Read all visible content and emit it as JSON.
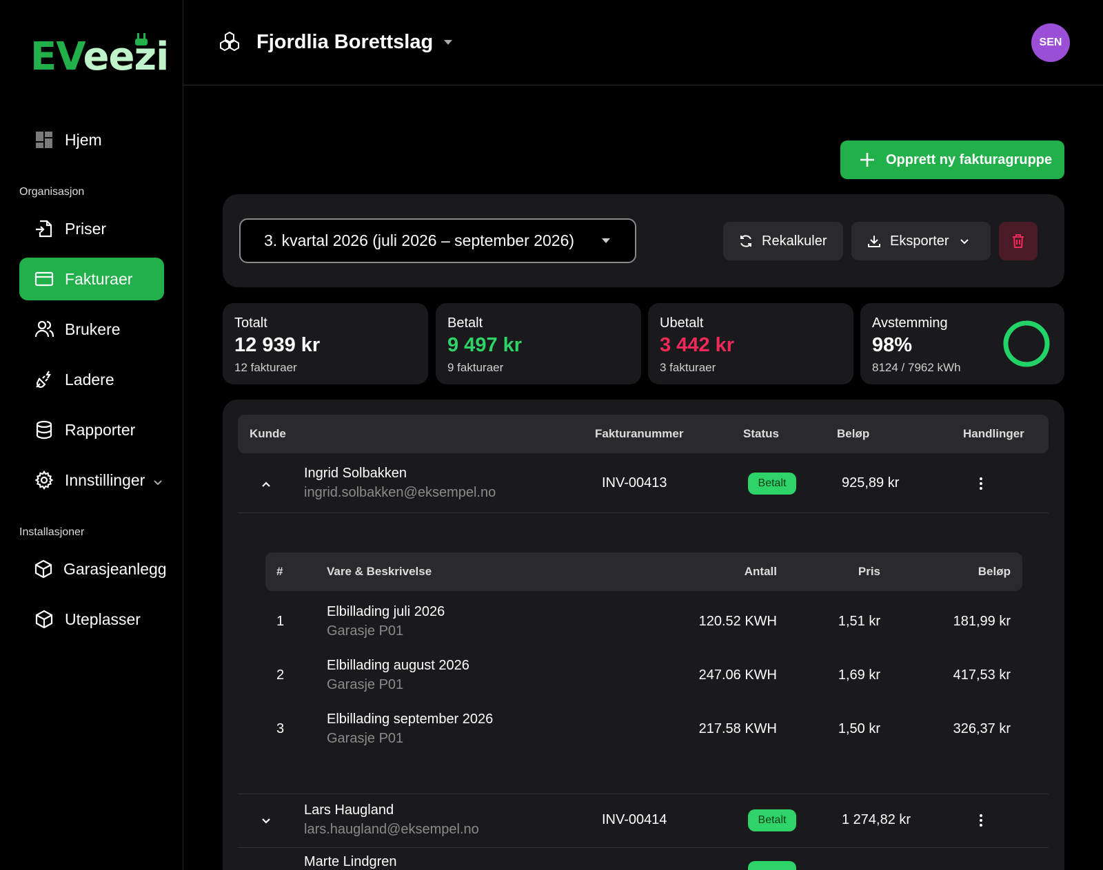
{
  "brand": {
    "logo_ev": "EV",
    "logo_eezi": "eezi",
    "accent": "#22b04b"
  },
  "sidebar": {
    "home": "Hjem",
    "section_org": "Organisasjon",
    "items": [
      {
        "label": "Priser",
        "icon": "price-import-icon"
      },
      {
        "label": "Fakturaer",
        "icon": "invoice-card-icon",
        "active": true
      },
      {
        "label": "Brukere",
        "icon": "users-icon"
      },
      {
        "label": "Ladere",
        "icon": "charger-plug-icon"
      },
      {
        "label": "Rapporter",
        "icon": "database-icon"
      },
      {
        "label": "Innstillinger",
        "icon": "gear-icon"
      }
    ],
    "section_install": "Installasjoner",
    "installs": [
      {
        "label": "Garasjeanlegg",
        "icon": "box-icon"
      },
      {
        "label": "Uteplasser",
        "icon": "box-icon"
      }
    ]
  },
  "topbar": {
    "org_name": "Fjordlia Borettslag",
    "avatar": "SEN"
  },
  "actions": {
    "create_group": "Opprett ny fakturagruppe",
    "period": "3. kvartal 2026 (juli 2026 – september 2026)",
    "recalc": "Rekalkuler",
    "export": "Eksporter"
  },
  "stats": {
    "total": {
      "label": "Totalt",
      "value": "12 939 kr",
      "sub": "12 fakturaer"
    },
    "paid": {
      "label": "Betalt",
      "value": "9 497 kr",
      "sub": "9 fakturaer",
      "color": "#2ed468"
    },
    "unpaid": {
      "label": "Ubetalt",
      "value": "3 442 kr",
      "sub": "3 fakturaer",
      "color": "#f0295a"
    },
    "reconcile": {
      "label": "Avstemming",
      "value": "98%",
      "sub": "8124 / 7962 kWh",
      "progress": 0.98
    }
  },
  "table": {
    "headers": {
      "customer": "Kunde",
      "invoice_no": "Fakturanummer",
      "status": "Status",
      "amount": "Beløp",
      "actions": "Handlinger"
    },
    "rows": [
      {
        "name": "Ingrid Solbakken",
        "email": "ingrid.solbakken@eksempel.no",
        "invoice": "INV-00413",
        "status": "Betalt",
        "amount": "925,89 kr",
        "expanded": true
      },
      {
        "name": "Lars Haugland",
        "email": "lars.haugland@eksempel.no",
        "invoice": "INV-00414",
        "status": "Betalt",
        "amount": "1 274,82 kr",
        "expanded": false
      },
      {
        "name": "Marte Lindgren"
      }
    ]
  },
  "lines": {
    "headers": {
      "num": "#",
      "item": "Vare & Beskrivelse",
      "qty": "Antall",
      "price": "Pris",
      "amount": "Beløp"
    },
    "rows": [
      {
        "num": "1",
        "desc": "Elbillading juli 2026",
        "loc": "Garasje P01",
        "qty": "120.52 KWH",
        "price": "1,51 kr",
        "amount": "181,99 kr"
      },
      {
        "num": "2",
        "desc": "Elbillading august 2026",
        "loc": "Garasje P01",
        "qty": "247.06 KWH",
        "price": "1,69 kr",
        "amount": "417,53 kr"
      },
      {
        "num": "3",
        "desc": "Elbillading september 2026",
        "loc": "Garasje P01",
        "qty": "217.58 KWH",
        "price": "1,50 kr",
        "amount": "326,37 kr"
      }
    ]
  }
}
